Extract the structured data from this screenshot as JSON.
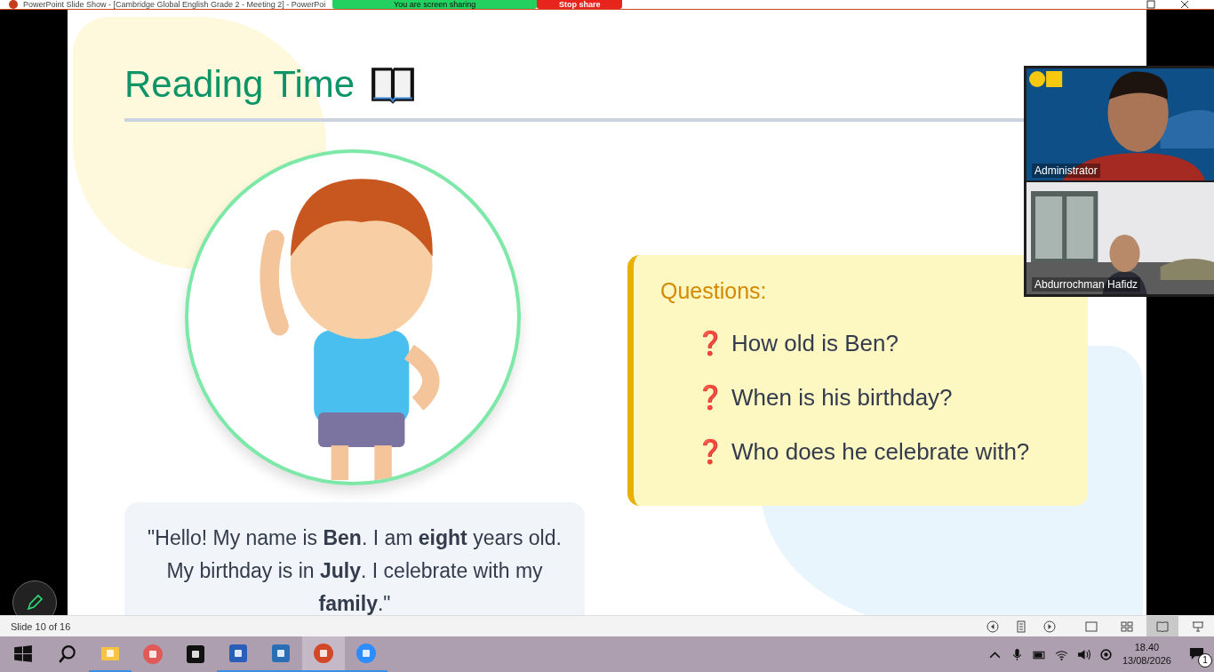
{
  "window": {
    "title": "PowerPoint Slide Show - [Cambridge Global English Grade 2 - Meeting 2] - PowerPoi"
  },
  "share_banner": {
    "status": "You are screen sharing",
    "stop_button": "Stop share"
  },
  "slide": {
    "title": "Reading Time",
    "quote": "\"Hello! My name is **Ben**. I am **eight** years old. My birthday is in **July**. I celebrate with my **family**.\"",
    "questions_heading": "Questions:",
    "questions": [
      {
        "marker": "❓",
        "text": "How old is Ben?"
      },
      {
        "marker": "❓",
        "text": "When is his birthday?"
      },
      {
        "marker": "❓",
        "text": "Who does he celebrate with?"
      }
    ]
  },
  "participants": [
    {
      "name": "Administrator",
      "kind": "picture"
    },
    {
      "name": "Abdurrochman Hafidz",
      "kind": "picture"
    }
  ],
  "status_bar": {
    "slide_counter": "Slide 10 of 16",
    "views": [
      {
        "kind": "normal",
        "selected": false
      },
      {
        "kind": "sorter",
        "selected": false
      },
      {
        "kind": "reading",
        "selected": true
      },
      {
        "kind": "slideshow",
        "selected": false
      }
    ]
  },
  "taskbar": {
    "apps": [
      {
        "kind": "files",
        "selected": false,
        "running": true
      },
      {
        "kind": "snip",
        "selected": false,
        "running": false
      },
      {
        "kind": "tradingview",
        "selected": false,
        "running": false
      },
      {
        "kind": "word",
        "selected": false,
        "running": true
      },
      {
        "kind": "maxthon",
        "selected": false,
        "running": true
      },
      {
        "kind": "powerpoint",
        "selected": true,
        "running": true
      },
      {
        "kind": "zoom",
        "selected": false,
        "running": true
      }
    ],
    "time": "18.40",
    "date": "13/08/2026",
    "notifications": "1"
  }
}
